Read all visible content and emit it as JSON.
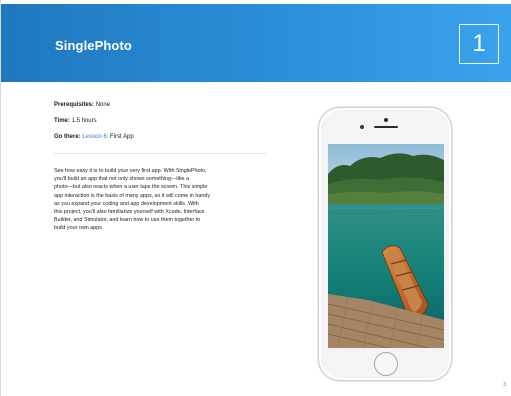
{
  "header": {
    "title": "SinglePhoto",
    "chapter_number": "1",
    "accent_color": "#2b8fd9"
  },
  "meta": {
    "prerequisites_label": "Prerequisites:",
    "prerequisites_value": "None",
    "time_label": "Time:",
    "time_value": "1.5 hours",
    "go_there_label": "Go there:",
    "go_there_link": "Lesson 6:",
    "go_there_value": "First App"
  },
  "body": {
    "lines": [
      "See how easy it is to build your very first app. With SinglePhoto,",
      "you'll build an app that not only shows something—like a",
      "photo—but also reacts when a user taps the screen. This simple",
      "app interaction is the basis of many apps, so it will come in handy",
      "as you expand your coding and app development skills. With",
      "this project, you'll also familiarize yourself with Xcode, Interface",
      "Builder, and Simulator, and learn how to use them together to",
      "build your own apps."
    ]
  },
  "footer": {
    "page_number": "3"
  }
}
